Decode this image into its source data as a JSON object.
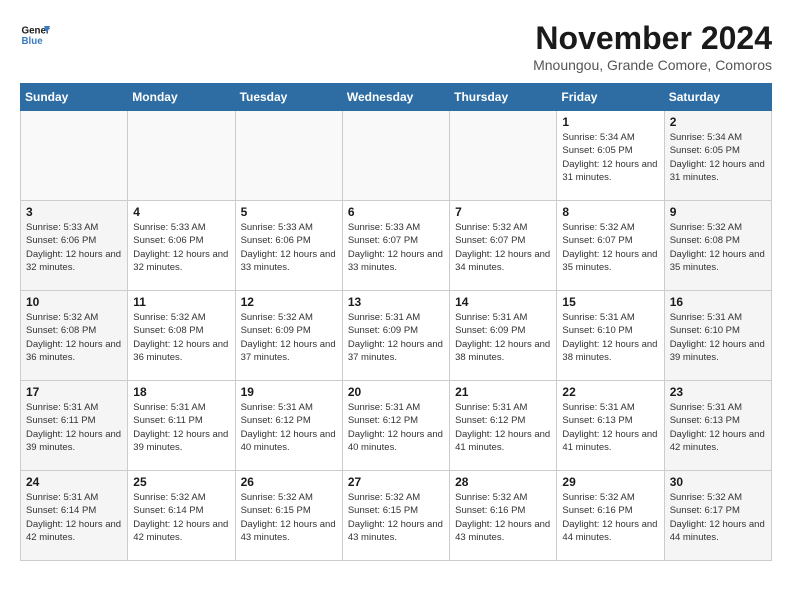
{
  "header": {
    "logo_line1": "General",
    "logo_line2": "Blue",
    "month_title": "November 2024",
    "location": "Mnoungou, Grande Comore, Comoros"
  },
  "weekdays": [
    "Sunday",
    "Monday",
    "Tuesday",
    "Wednesday",
    "Thursday",
    "Friday",
    "Saturday"
  ],
  "weeks": [
    [
      {
        "day": "",
        "info": ""
      },
      {
        "day": "",
        "info": ""
      },
      {
        "day": "",
        "info": ""
      },
      {
        "day": "",
        "info": ""
      },
      {
        "day": "",
        "info": ""
      },
      {
        "day": "1",
        "info": "Sunrise: 5:34 AM\nSunset: 6:05 PM\nDaylight: 12 hours and 31 minutes."
      },
      {
        "day": "2",
        "info": "Sunrise: 5:34 AM\nSunset: 6:05 PM\nDaylight: 12 hours and 31 minutes."
      }
    ],
    [
      {
        "day": "3",
        "info": "Sunrise: 5:33 AM\nSunset: 6:06 PM\nDaylight: 12 hours and 32 minutes."
      },
      {
        "day": "4",
        "info": "Sunrise: 5:33 AM\nSunset: 6:06 PM\nDaylight: 12 hours and 32 minutes."
      },
      {
        "day": "5",
        "info": "Sunrise: 5:33 AM\nSunset: 6:06 PM\nDaylight: 12 hours and 33 minutes."
      },
      {
        "day": "6",
        "info": "Sunrise: 5:33 AM\nSunset: 6:07 PM\nDaylight: 12 hours and 33 minutes."
      },
      {
        "day": "7",
        "info": "Sunrise: 5:32 AM\nSunset: 6:07 PM\nDaylight: 12 hours and 34 minutes."
      },
      {
        "day": "8",
        "info": "Sunrise: 5:32 AM\nSunset: 6:07 PM\nDaylight: 12 hours and 35 minutes."
      },
      {
        "day": "9",
        "info": "Sunrise: 5:32 AM\nSunset: 6:08 PM\nDaylight: 12 hours and 35 minutes."
      }
    ],
    [
      {
        "day": "10",
        "info": "Sunrise: 5:32 AM\nSunset: 6:08 PM\nDaylight: 12 hours and 36 minutes."
      },
      {
        "day": "11",
        "info": "Sunrise: 5:32 AM\nSunset: 6:08 PM\nDaylight: 12 hours and 36 minutes."
      },
      {
        "day": "12",
        "info": "Sunrise: 5:32 AM\nSunset: 6:09 PM\nDaylight: 12 hours and 37 minutes."
      },
      {
        "day": "13",
        "info": "Sunrise: 5:31 AM\nSunset: 6:09 PM\nDaylight: 12 hours and 37 minutes."
      },
      {
        "day": "14",
        "info": "Sunrise: 5:31 AM\nSunset: 6:09 PM\nDaylight: 12 hours and 38 minutes."
      },
      {
        "day": "15",
        "info": "Sunrise: 5:31 AM\nSunset: 6:10 PM\nDaylight: 12 hours and 38 minutes."
      },
      {
        "day": "16",
        "info": "Sunrise: 5:31 AM\nSunset: 6:10 PM\nDaylight: 12 hours and 39 minutes."
      }
    ],
    [
      {
        "day": "17",
        "info": "Sunrise: 5:31 AM\nSunset: 6:11 PM\nDaylight: 12 hours and 39 minutes."
      },
      {
        "day": "18",
        "info": "Sunrise: 5:31 AM\nSunset: 6:11 PM\nDaylight: 12 hours and 39 minutes."
      },
      {
        "day": "19",
        "info": "Sunrise: 5:31 AM\nSunset: 6:12 PM\nDaylight: 12 hours and 40 minutes."
      },
      {
        "day": "20",
        "info": "Sunrise: 5:31 AM\nSunset: 6:12 PM\nDaylight: 12 hours and 40 minutes."
      },
      {
        "day": "21",
        "info": "Sunrise: 5:31 AM\nSunset: 6:12 PM\nDaylight: 12 hours and 41 minutes."
      },
      {
        "day": "22",
        "info": "Sunrise: 5:31 AM\nSunset: 6:13 PM\nDaylight: 12 hours and 41 minutes."
      },
      {
        "day": "23",
        "info": "Sunrise: 5:31 AM\nSunset: 6:13 PM\nDaylight: 12 hours and 42 minutes."
      }
    ],
    [
      {
        "day": "24",
        "info": "Sunrise: 5:31 AM\nSunset: 6:14 PM\nDaylight: 12 hours and 42 minutes."
      },
      {
        "day": "25",
        "info": "Sunrise: 5:32 AM\nSunset: 6:14 PM\nDaylight: 12 hours and 42 minutes."
      },
      {
        "day": "26",
        "info": "Sunrise: 5:32 AM\nSunset: 6:15 PM\nDaylight: 12 hours and 43 minutes."
      },
      {
        "day": "27",
        "info": "Sunrise: 5:32 AM\nSunset: 6:15 PM\nDaylight: 12 hours and 43 minutes."
      },
      {
        "day": "28",
        "info": "Sunrise: 5:32 AM\nSunset: 6:16 PM\nDaylight: 12 hours and 43 minutes."
      },
      {
        "day": "29",
        "info": "Sunrise: 5:32 AM\nSunset: 6:16 PM\nDaylight: 12 hours and 44 minutes."
      },
      {
        "day": "30",
        "info": "Sunrise: 5:32 AM\nSunset: 6:17 PM\nDaylight: 12 hours and 44 minutes."
      }
    ]
  ]
}
